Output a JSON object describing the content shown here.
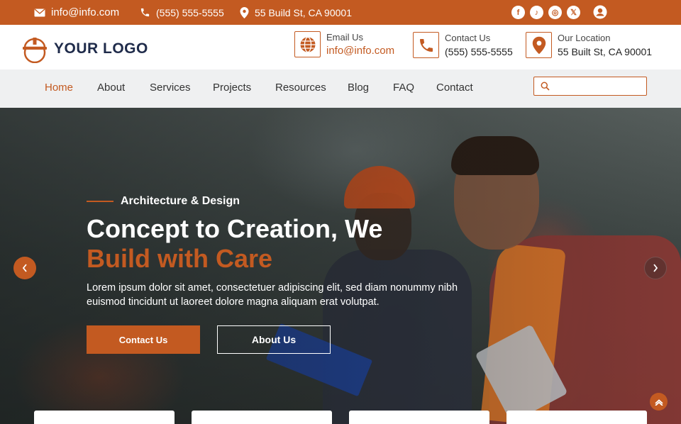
{
  "topbar": {
    "email": "info@info.com",
    "phone": "(555) 555-5555",
    "address": "55 Build St, CA 90001",
    "socials": [
      {
        "icon": "facebook-icon",
        "glyph": "f"
      },
      {
        "icon": "tiktok-icon",
        "glyph": "♪"
      },
      {
        "icon": "instagram-icon",
        "glyph": "◎"
      },
      {
        "icon": "x-icon",
        "glyph": "𝕏"
      }
    ]
  },
  "header": {
    "logo_text": "YOUR LOGO",
    "email_label": "Email Us",
    "email_value": "info@info.com",
    "contact_label": "Contact Us",
    "contact_value": "(555) 555-5555",
    "location_label": "Our Location",
    "location_value": "55 Built St, CA 90001"
  },
  "nav": {
    "items": [
      "Home",
      "About",
      "Services",
      "Projects",
      "Resources",
      "Blog",
      "FAQ",
      "Contact"
    ],
    "active": "Home",
    "search_placeholder": ""
  },
  "hero": {
    "eyebrow": "Architecture & Design",
    "title_line1": "Concept to Creation, We",
    "title_line2": "Build with Care",
    "body": "Lorem ipsum dolor sit amet, consectetuer adipiscing elit, sed diam nonummy nibh euismod tincidunt ut laoreet dolore magna aliquam erat volutpat.",
    "primary_button": "Contact Us",
    "secondary_button": "About Us"
  },
  "colors": {
    "accent": "#c35a21",
    "navy": "#1f2b4a",
    "nav_bg": "#eff0f1"
  }
}
